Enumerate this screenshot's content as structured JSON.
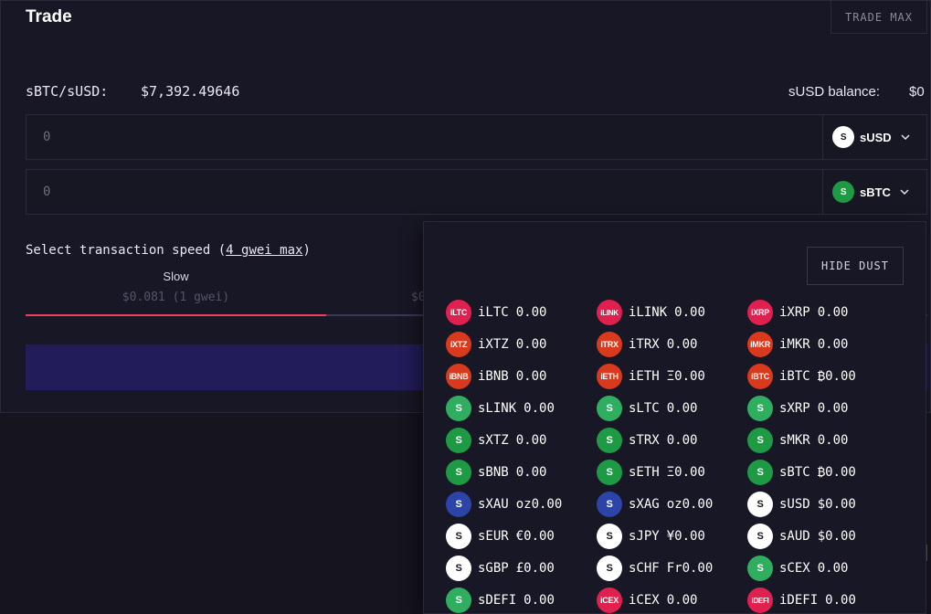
{
  "header": {
    "title": "Trade",
    "trade_max_label": "TRADE MAX"
  },
  "pair": {
    "label": "sBTC/sUSD:",
    "price": "$7,392.49646"
  },
  "balance": {
    "label": "sUSD balance:",
    "value": "$0"
  },
  "inputs": [
    {
      "placeholder": "0",
      "currency": "sUSD",
      "icon_bg": "#ffffff",
      "icon_fg": "#15141f"
    },
    {
      "placeholder": "0",
      "currency": "sBTC",
      "icon_bg": "#1e9a44",
      "icon_fg": "#ffffff"
    }
  ],
  "speed": {
    "label_prefix": "Select transaction speed (",
    "label_link": "4 gwei max",
    "label_suffix": ")",
    "slow_name": "Slow",
    "slow_cost": "$0.081 (1 gwei)",
    "avg_cost_partial": "$0",
    "fill_fraction": 0.333
  },
  "dropdown": {
    "hide_dust_label": "HIDE DUST",
    "tokens": [
      {
        "symbol": "iLTC",
        "balance": "0.00",
        "icon_text": "iLTC",
        "color": "#e0204f"
      },
      {
        "symbol": "iLINK",
        "balance": "0.00",
        "icon_text": "iLINK",
        "color": "#e0204f"
      },
      {
        "symbol": "iXRP",
        "balance": "0.00",
        "icon_text": "iXRP",
        "color": "#e0204f"
      },
      {
        "symbol": "iXTZ",
        "balance": "0.00",
        "icon_text": "iXTZ",
        "color": "#d9391c"
      },
      {
        "symbol": "iTRX",
        "balance": "0.00",
        "icon_text": "iTRX",
        "color": "#d9391c"
      },
      {
        "symbol": "iMKR",
        "balance": "0.00",
        "icon_text": "iMKR",
        "color": "#d9391c"
      },
      {
        "symbol": "iBNB",
        "balance": "0.00",
        "icon_text": "iBNB",
        "color": "#d9391c"
      },
      {
        "symbol": "iETH",
        "balance": "Ξ0.00",
        "icon_text": "iETH",
        "color": "#d9391c"
      },
      {
        "symbol": "iBTC",
        "balance": "₿0.00",
        "icon_text": "iBTC",
        "color": "#d9391c"
      },
      {
        "symbol": "sLINK",
        "balance": "0.00",
        "icon_text": "S",
        "color": "#2fae5f"
      },
      {
        "symbol": "sLTC",
        "balance": "0.00",
        "icon_text": "S",
        "color": "#2fae5f"
      },
      {
        "symbol": "sXRP",
        "balance": "0.00",
        "icon_text": "S",
        "color": "#2fae5f"
      },
      {
        "symbol": "sXTZ",
        "balance": "0.00",
        "icon_text": "S",
        "color": "#1e9a44"
      },
      {
        "symbol": "sTRX",
        "balance": "0.00",
        "icon_text": "S",
        "color": "#1e9a44"
      },
      {
        "symbol": "sMKR",
        "balance": "0.00",
        "icon_text": "S",
        "color": "#1e9a44"
      },
      {
        "symbol": "sBNB",
        "balance": "0.00",
        "icon_text": "S",
        "color": "#1e9a44"
      },
      {
        "symbol": "sETH",
        "balance": "Ξ0.00",
        "icon_text": "S",
        "color": "#1e9a44"
      },
      {
        "symbol": "sBTC",
        "balance": "₿0.00",
        "icon_text": "S",
        "color": "#1e9a44"
      },
      {
        "symbol": "sXAU",
        "balance": "oz0.00",
        "icon_text": "S",
        "color": "#2c44a8"
      },
      {
        "symbol": "sXAG",
        "balance": "oz0.00",
        "icon_text": "S",
        "color": "#2c44a8"
      },
      {
        "symbol": "sUSD",
        "balance": "$0.00",
        "icon_text": "S",
        "color": "#ffffff"
      },
      {
        "symbol": "sEUR",
        "balance": "€0.00",
        "icon_text": "S",
        "color": "#ffffff"
      },
      {
        "symbol": "sJPY",
        "balance": "¥0.00",
        "icon_text": "S",
        "color": "#ffffff"
      },
      {
        "symbol": "sAUD",
        "balance": "$0.00",
        "icon_text": "S",
        "color": "#ffffff"
      },
      {
        "symbol": "sGBP",
        "balance": "£0.00",
        "icon_text": "S",
        "color": "#ffffff"
      },
      {
        "symbol": "sCHF",
        "balance": "Fr0.00",
        "icon_text": "S",
        "color": "#ffffff"
      },
      {
        "symbol": "sCEX",
        "balance": "0.00",
        "icon_text": "S",
        "color": "#2fae5f"
      },
      {
        "symbol": "sDEFI",
        "balance": "0.00",
        "icon_text": "S",
        "color": "#2fae5f"
      },
      {
        "symbol": "iCEX",
        "balance": "0.00",
        "icon_text": "iCEX",
        "color": "#e0204f"
      },
      {
        "symbol": "iDEFI",
        "balance": "0.00",
        "icon_text": "iDEFI",
        "color": "#e0204f"
      }
    ]
  }
}
